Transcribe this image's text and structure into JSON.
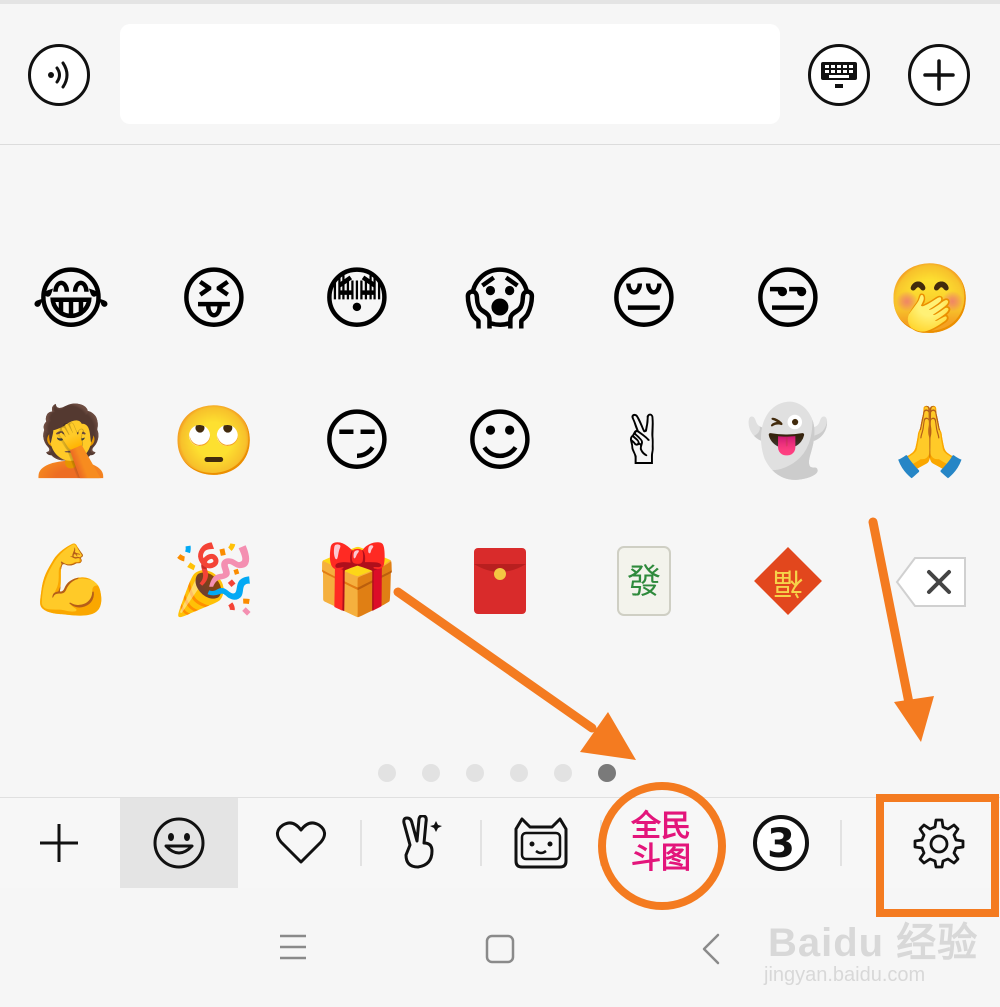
{
  "input_bar": {
    "voice_icon": "voice-icon",
    "message_value": "",
    "keyboard_icon": "keyboard-icon",
    "plus_icon": "plus-icon"
  },
  "emoji_grid": {
    "rows": [
      [
        "😂",
        "😝",
        "😳",
        "😱",
        "😔",
        "😒",
        "🤭"
      ],
      [
        "🤦",
        "🙄",
        "😏",
        "☺",
        "✌",
        "👻",
        "🙏"
      ],
      [
        "💪",
        "🎉",
        "🎁",
        "🧧",
        "🀅",
        "福",
        ""
      ]
    ],
    "delete_icon": "backspace-icon"
  },
  "pager": {
    "count": 6,
    "active_index": 5
  },
  "toolbar": {
    "items": [
      {
        "name": "add",
        "icon": "plus-icon"
      },
      {
        "name": "emoji",
        "icon": "smiley-icon",
        "selected": true
      },
      {
        "name": "favorites",
        "icon": "heart-icon"
      },
      {
        "name": "gestures",
        "icon": "victory-hand-icon"
      },
      {
        "name": "tv-cat",
        "icon": "tv-cat-icon"
      },
      {
        "name": "quanmin-doutu",
        "label_line1": "全民",
        "label_line2": "斗图"
      },
      {
        "name": "sticker-3",
        "label": "3"
      },
      {
        "name": "settings",
        "icon": "gear-icon"
      }
    ]
  },
  "nav": {
    "menu_icon": "menu-icon",
    "home_icon": "home-icon",
    "back_icon": "back-icon"
  },
  "watermark": {
    "main": "Baidu 经验",
    "sub": "jingyan.baidu.com"
  },
  "annotations": {
    "color": "#f47b20"
  }
}
